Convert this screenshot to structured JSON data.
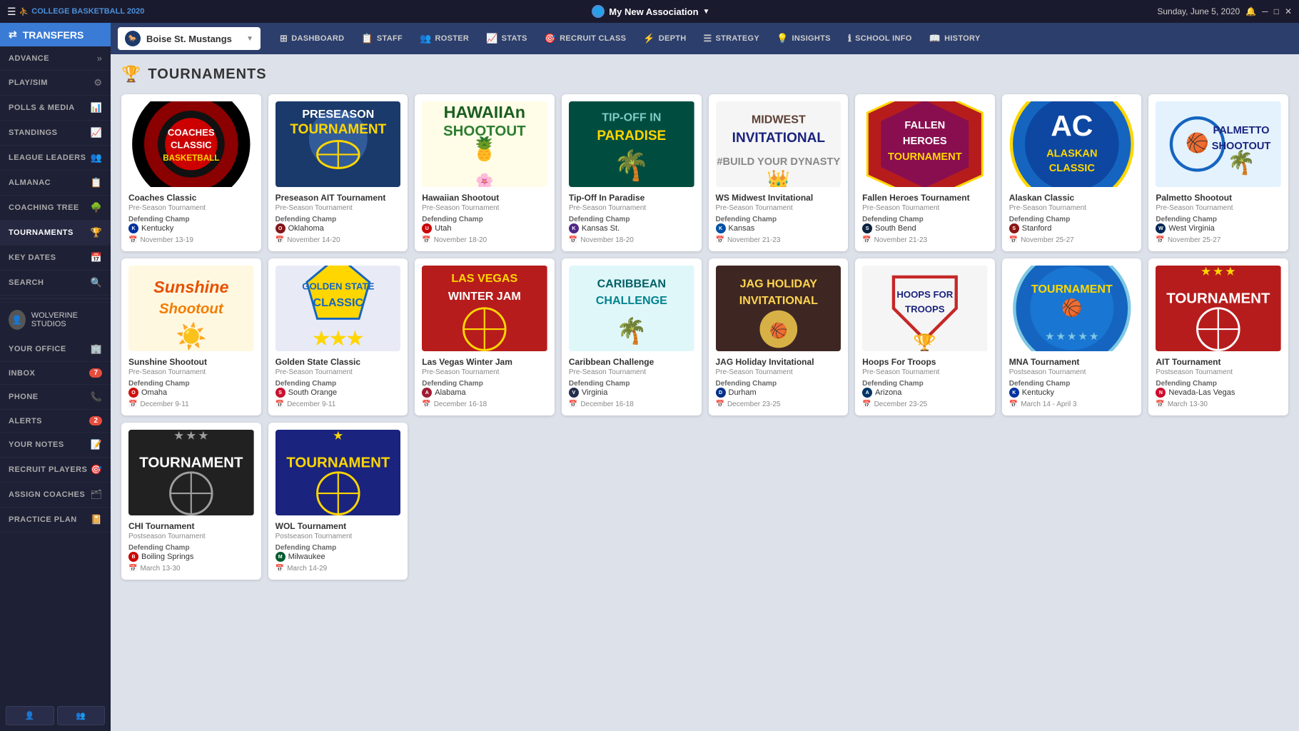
{
  "app": {
    "title": "My New Association",
    "date": "Sunday, June 5, 2020",
    "logo_text": "COLLEGE BASKETBALL 2020"
  },
  "sidebar": {
    "transfers_label": "TRANSFERS",
    "items": [
      {
        "id": "advance",
        "label": "ADVANCE",
        "icon": "»",
        "active": false
      },
      {
        "id": "play-sim",
        "label": "PLAY/SIM",
        "icon": "⚙",
        "active": false
      },
      {
        "id": "polls-media",
        "label": "POLLS & MEDIA",
        "icon": "📊",
        "active": false
      },
      {
        "id": "standings",
        "label": "STANDINGS",
        "icon": "📈",
        "active": false
      },
      {
        "id": "league-leaders",
        "label": "LEAGUE LEADERS",
        "icon": "👥",
        "active": false
      },
      {
        "id": "almanac",
        "label": "ALMANAC",
        "icon": "📋",
        "active": false
      },
      {
        "id": "coaching-tree",
        "label": "COACHING TREE",
        "icon": "🌳",
        "active": false
      },
      {
        "id": "tournaments",
        "label": "TOURNAMENTS",
        "icon": "🏆",
        "active": true
      },
      {
        "id": "key-dates",
        "label": "KEY DATES",
        "icon": "📅",
        "active": false
      },
      {
        "id": "search",
        "label": "SEARCH",
        "icon": "🔍",
        "active": false
      }
    ],
    "user_name": "WOLVERINE STUDIOS",
    "office_label": "YOUR OFFICE",
    "inbox_label": "INBOX",
    "inbox_badge": "7",
    "phone_label": "PHONE",
    "alerts_label": "ALERTS",
    "alerts_badge": "2",
    "notes_label": "YOUR NOTES",
    "recruit_players_label": "RECRUIT PLAYERS",
    "assign_coaches_label": "ASSIGN COACHES",
    "practice_plan_label": "PRACTICE PLAN",
    "btn_profile": "👤",
    "btn_add": "👥"
  },
  "nav": {
    "team_name": "Boise St. Mustangs",
    "items": [
      {
        "id": "dashboard",
        "label": "DASHBOARD",
        "icon": "⊞"
      },
      {
        "id": "staff",
        "label": "STAFF",
        "icon": "📋"
      },
      {
        "id": "roster",
        "label": "ROSTER",
        "icon": "👥"
      },
      {
        "id": "stats",
        "label": "STATS",
        "icon": "📈"
      },
      {
        "id": "recruit-class",
        "label": "RECRUIT CLASS",
        "icon": "🎯"
      },
      {
        "id": "depth",
        "label": "DEPTH",
        "icon": "⚡"
      },
      {
        "id": "strategy",
        "label": "STRATEGY",
        "icon": "☰"
      },
      {
        "id": "insights",
        "label": "INSIGHTS",
        "icon": "💡"
      },
      {
        "id": "school-info",
        "label": "SCHOOL INFO",
        "icon": "ℹ"
      },
      {
        "id": "history",
        "label": "HISTORY",
        "icon": "📖"
      }
    ]
  },
  "page": {
    "title": "TOURNAMENTS",
    "tournaments": [
      {
        "id": "coaches-classic",
        "name": "Coaches Classic",
        "type": "Pre-Season Tournament",
        "logo_type": "coaches-classic",
        "logo_text": "COACHES CLASSIC",
        "defending_champ": "Kentucky",
        "champ_initial": "K",
        "champ_color": "#0033A0",
        "dates": "November 13-19"
      },
      {
        "id": "preseason-ait",
        "name": "Preseason AIT Tournament",
        "type": "Pre-Season Tournament",
        "logo_type": "preseason-ait",
        "logo_text": "PRESEASON TOURNAMENT",
        "defending_champ": "Oklahoma",
        "champ_initial": "O",
        "champ_color": "#841617",
        "dates": "November 14-20"
      },
      {
        "id": "hawaiian-shootout",
        "name": "Hawaiian Shootout",
        "type": "Pre-Season Tournament",
        "logo_type": "hawaiian",
        "logo_text": "HAWAIIAN SHOOTOUT",
        "defending_champ": "Utah",
        "champ_initial": "U",
        "champ_color": "#CC0000",
        "dates": "November 18-20"
      },
      {
        "id": "tip-off-paradise",
        "name": "Tip-Off In Paradise",
        "type": "Pre-Season Tournament",
        "logo_type": "tip-off",
        "logo_text": "TIP-OFF IN PARADISE",
        "defending_champ": "Kansas St.",
        "champ_initial": "K",
        "champ_color": "#512888",
        "dates": "November 18-20"
      },
      {
        "id": "ws-midwest",
        "name": "WS Midwest Invitational",
        "type": "Pre-Season Tournament",
        "logo_type": "midwest",
        "logo_text": "MIDWEST INVITATIONAL",
        "defending_champ": "Kansas",
        "champ_initial": "K",
        "champ_color": "#0051A5",
        "dates": "November 21-23"
      },
      {
        "id": "fallen-heroes",
        "name": "Fallen Heroes Tournament",
        "type": "Pre-Season Tournament",
        "logo_type": "fallen-heroes",
        "logo_text": "FALLEN HEROES TOURNAMENT",
        "defending_champ": "South Bend",
        "champ_initial": "S",
        "champ_color": "#0C2340",
        "dates": "November 21-23"
      },
      {
        "id": "alaskan-classic",
        "name": "Alaskan Classic",
        "type": "Pre-Season Tournament",
        "logo_type": "alaskan",
        "logo_text": "AC ALASKAN CLASSIC",
        "defending_champ": "Stanford",
        "champ_initial": "S",
        "champ_color": "#8C1515",
        "dates": "November 25-27"
      },
      {
        "id": "palmetto-shootout",
        "name": "Palmetto Shootout",
        "type": "Pre-Season Tournament",
        "logo_type": "palmetto",
        "logo_text": "PALMETTO SHOOTOUT",
        "defending_champ": "West Virginia",
        "champ_initial": "W",
        "champ_color": "#002855",
        "dates": "November 25-27"
      },
      {
        "id": "sunshine-shootout",
        "name": "Sunshine Shootout",
        "type": "Pre-Season Tournament",
        "logo_type": "sunshine",
        "logo_text": "Sunshine Shootout",
        "defending_champ": "Omaha",
        "champ_initial": "O",
        "champ_color": "#D01010",
        "dates": "December 9-11"
      },
      {
        "id": "golden-state",
        "name": "Golden State Classic",
        "type": "Pre-Season Tournament",
        "logo_type": "golden-state",
        "logo_text": "GOLDEN STATE CLASSIC",
        "defending_champ": "South Orange",
        "champ_initial": "S",
        "champ_color": "#c8102e",
        "dates": "December 9-11"
      },
      {
        "id": "las-vegas",
        "name": "Las Vegas Winter Jam",
        "type": "Pre-Season Tournament",
        "logo_type": "las-vegas",
        "logo_text": "LAS VEGAS WINTER JAM",
        "defending_champ": "Alabama",
        "champ_initial": "A",
        "champ_color": "#9E1B32",
        "dates": "December 16-18"
      },
      {
        "id": "caribbean",
        "name": "Caribbean Challenge",
        "type": "Pre-Season Tournament",
        "logo_type": "caribbean",
        "logo_text": "CARIBBEAN CHALLENGE",
        "defending_champ": "Virginia",
        "champ_initial": "V",
        "champ_color": "#232D4B",
        "dates": "December 16-18"
      },
      {
        "id": "jag-holiday",
        "name": "JAG Holiday Invitational",
        "type": "Pre-Season Tournament",
        "logo_type": "jag",
        "logo_text": "JAG HOLIDAY INVITATIONAL",
        "defending_champ": "Durham",
        "champ_initial": "D",
        "champ_color": "#003087",
        "dates": "December 23-25"
      },
      {
        "id": "hoops-troops",
        "name": "Hoops For Troops",
        "type": "Pre-Season Tournament",
        "logo_type": "hoops",
        "logo_text": "HOOPS FOR TROOPS",
        "defending_champ": "Arizona",
        "champ_initial": "A",
        "champ_color": "#003366",
        "dates": "December 23-25"
      },
      {
        "id": "mna-tournament",
        "name": "MNA Tournament",
        "type": "Postseason Tournament",
        "logo_type": "mna",
        "logo_text": "MNA TOURNAMENT",
        "defending_champ": "Kentucky",
        "champ_initial": "K",
        "champ_color": "#0033A0",
        "dates": "March 14 - April 3"
      },
      {
        "id": "ait-tournament",
        "name": "AIT Tournament",
        "type": "Postseason Tournament",
        "logo_type": "ait",
        "logo_text": "TOURNAMENT",
        "defending_champ": "Nevada-Las Vegas",
        "champ_initial": "N",
        "champ_color": "#CF0A2C",
        "dates": "March 13-30"
      },
      {
        "id": "chi-tournament",
        "name": "CHI Tournament",
        "type": "Postseason Tournament",
        "logo_type": "chi",
        "logo_text": "TOURNAMENT",
        "defending_champ": "Boiling Springs",
        "champ_initial": "B",
        "champ_color": "#CC0000",
        "dates": "March 13-30"
      },
      {
        "id": "wol-tournament",
        "name": "WOL Tournament",
        "type": "Postseason Tournament",
        "logo_type": "wol",
        "logo_text": "TOURNAMENT",
        "defending_champ": "Milwaukee",
        "champ_initial": "M",
        "champ_color": "#005C2E",
        "dates": "March 14-29"
      }
    ]
  }
}
